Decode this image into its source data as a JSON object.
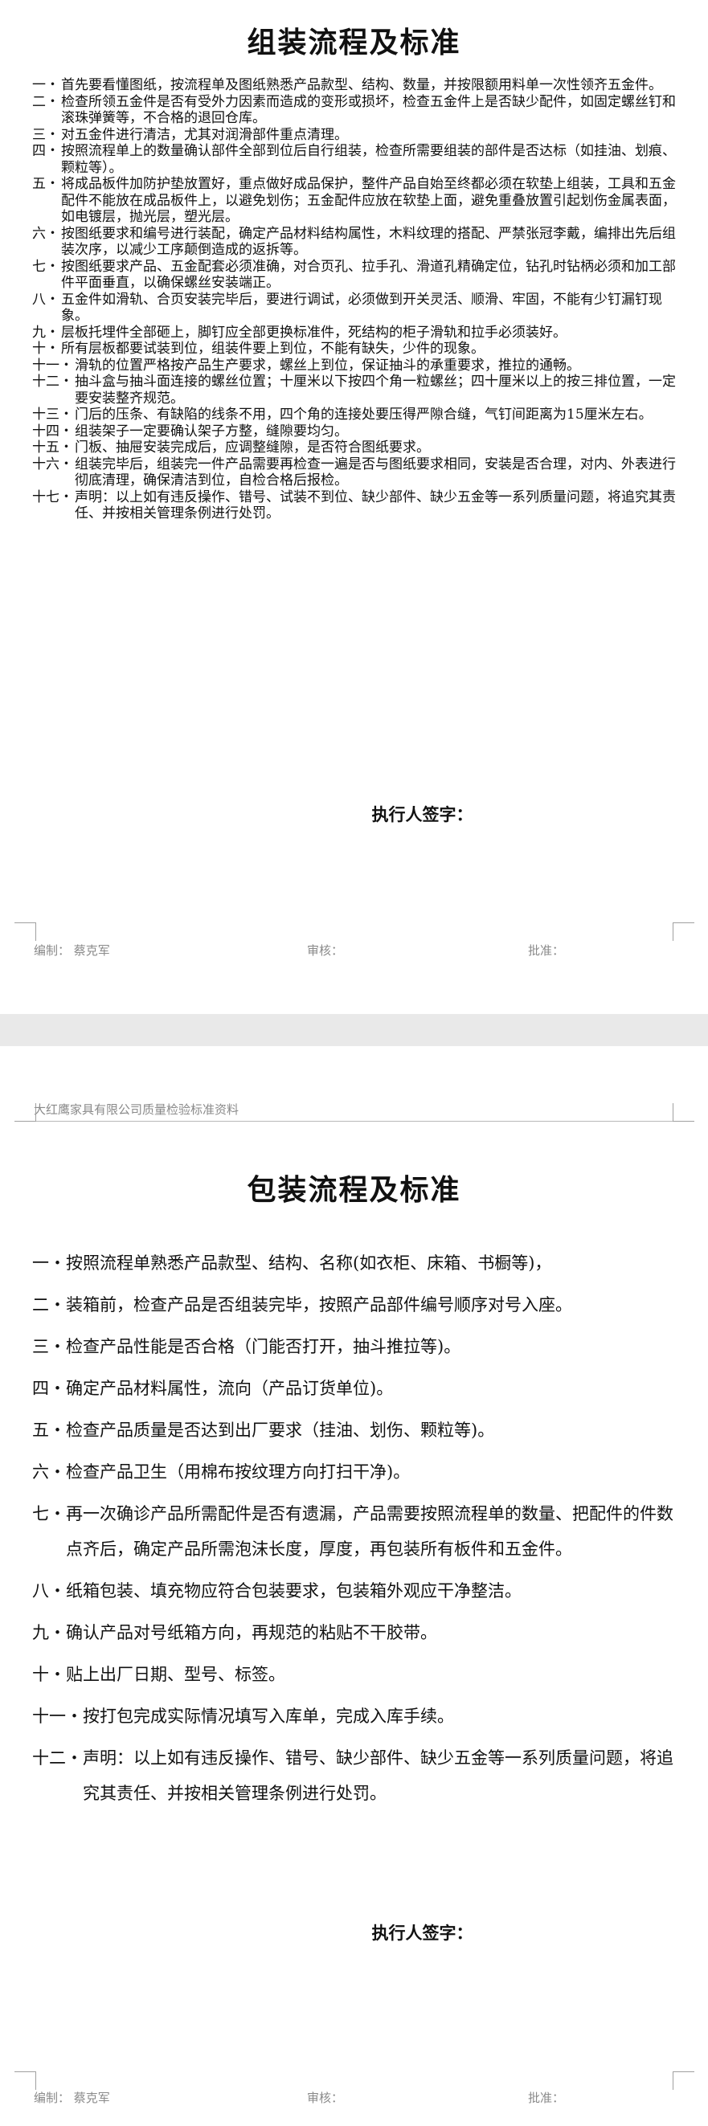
{
  "assembly": {
    "title": "组装流程及标准",
    "items": [
      {
        "num": "一・",
        "text": "首先要看懂图纸，按流程单及图纸熟悉产品款型、结构、数量，并按限额用料单一次性领齐五金件。"
      },
      {
        "num": "二・",
        "text": "检查所领五金件是否有受外力因素而造成的变形或损坏，检查五金件上是否缺少配件，如固定螺丝钉和滚珠弹簧等，不合格的退回仓库。"
      },
      {
        "num": "三・",
        "text": "对五金件进行清洁，尤其对润滑部件重点清理。"
      },
      {
        "num": "四・",
        "text": "按照流程单上的数量确认部件全部到位后自行组装，检查所需要组装的部件是否达标（如挂油、划痕、颗粒等）。"
      },
      {
        "num": "五・",
        "text": "将成品板件加防护垫放置好，重点做好成品保护，整件产品自始至终都必须在软垫上组装，工具和五金配件不能放在成品板件上，以避免划伤；五金配件应放在软垫上面，避免重叠放置引起划伤金属表面，如电镀层，抛光层，塑光层。"
      },
      {
        "num": "六・",
        "text": "按图纸要求和编号进行装配，确定产品材料结构属性，木料纹理的搭配、严禁张冠李戴，编排出先后组装次序，以减少工序颠倒造成的返拆等。"
      },
      {
        "num": "七・",
        "text": "按图纸要求产品、五金配套必须准确，对合页孔、拉手孔、滑道孔精确定位，钻孔时钻柄必须和加工部件平面垂直，以确保螺丝安装端正。"
      },
      {
        "num": "八・",
        "text": "五金件如滑轨、合页安装完毕后，要进行调试，必须做到开关灵活、顺滑、牢固，不能有少钉漏钉现象。"
      },
      {
        "num": "九・",
        "text": "层板托埋件全部砸上，脚钉应全部更换标准件，死结构的柜子滑轨和拉手必须装好。"
      },
      {
        "num": "十・",
        "text": "所有层板都要试装到位，组装件要上到位，不能有缺失，少件的现象。"
      },
      {
        "num": "十一・",
        "text": "滑轨的位置严格按产品生产要求，螺丝上到位，保证抽斗的承重要求，推拉的通畅。"
      },
      {
        "num": "十二・",
        "text": "抽斗盒与抽斗面连接的螺丝位置；十厘米以下按四个角一粒螺丝；四十厘米以上的按三排位置，一定要安装整齐规范。"
      },
      {
        "num": "十三・",
        "text": "门后的压条、有缺陷的线条不用，四个角的连接处要压得严隙合缝，气钉间距离为15厘米左右。"
      },
      {
        "num": "十四・",
        "text": "组装架子一定要确认架子方整，缝隙要均匀。"
      },
      {
        "num": "十五・",
        "text": "门板、抽屉安装完成后，应调整缝隙，是否符合图纸要求。"
      },
      {
        "num": "十六・",
        "text": "组装完毕后，组装完一件产品需要再检查一遍是否与图纸要求相同，安装是否合理，对内、外表进行彻底清理，确保清洁到位，自检合格后报检。"
      },
      {
        "num": "十七・",
        "text": "声明：以上如有违反操作、错号、试装不到位、缺少部件、缺少五金等一系列质量问题，将追究其责任、并按相关管理条例进行处罚。"
      }
    ],
    "sign": "执行人签字：",
    "footer": {
      "editor": "编制：  蔡克军",
      "review": "审核：",
      "approve": "批准："
    }
  },
  "header": "大红鹰家具有限公司质量检验标准资料",
  "packing": {
    "title": "包装流程及标准",
    "items": [
      {
        "num": "一・",
        "text": "按照流程单熟悉产品款型、结构、名称(如衣柜、床箱、书橱等)，"
      },
      {
        "num": "二・",
        "text": "装箱前，检查产品是否组装完毕，按照产品部件编号顺序对号入座。"
      },
      {
        "num": "三・",
        "text": "检查产品性能是否合格（门能否打开，抽斗推拉等)。"
      },
      {
        "num": "四・",
        "text": "确定产品材料属性，流向（产品订货单位)。"
      },
      {
        "num": "五・",
        "text": "检查产品质量是否达到出厂要求（挂油、划伤、颗粒等)。"
      },
      {
        "num": "六・",
        "text": "检查产品卫生（用棉布按纹理方向打扫干净)。"
      },
      {
        "num": "七・",
        "text": "再一次确诊产品所需配件是否有遗漏，产品需要按照流程单的数量、把配件的件数点齐后，确定产品所需泡沫长度，厚度，再包装所有板件和五金件。"
      },
      {
        "num": "八・",
        "text": "纸箱包装、填充物应符合包装要求，包装箱外观应干净整洁。"
      },
      {
        "num": "九・",
        "text": "确认产品对号纸箱方向，再规范的粘贴不干胶带。"
      },
      {
        "num": "十・",
        "text": "贴上出厂日期、型号、标签。"
      },
      {
        "num": "十一・",
        "text": "按打包完成实际情况填写入库单，完成入库手续。"
      },
      {
        "num": "十二・",
        "text": "声明：以上如有违反操作、错号、缺少部件、缺少五金等一系列质量问题，将追究其责任、并按相关管理条例进行处罚。"
      }
    ],
    "sign": "执行人签字：",
    "footer": {
      "editor": "编制：  蔡克军",
      "review": "审核：",
      "approve": "批准："
    }
  }
}
